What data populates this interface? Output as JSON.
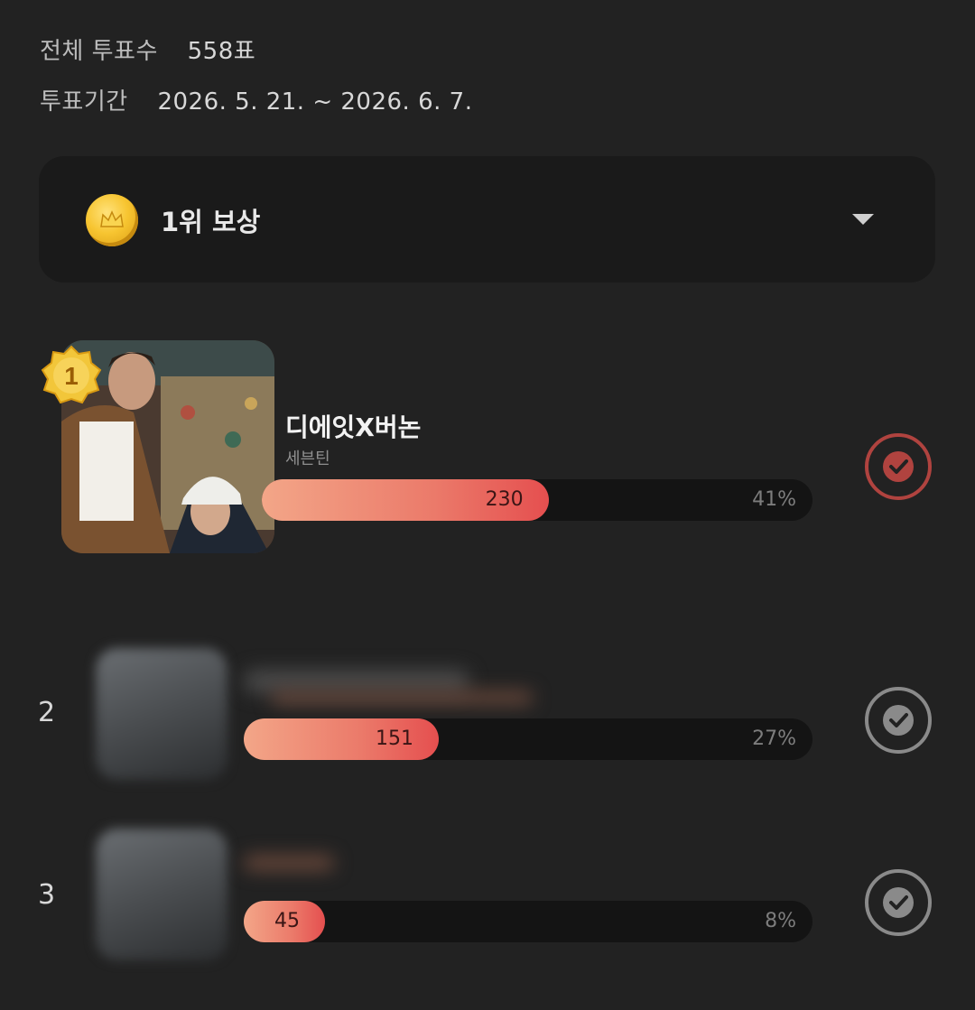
{
  "header": {
    "total_label": "전체 투표수",
    "total_value": "558표",
    "period_label": "투표기간",
    "period_value": "2026. 5. 21. ~ 2026. 6. 7."
  },
  "reward": {
    "title": "1위 보상",
    "icon": "coin-icon",
    "dropdown_icon": "chevron-down-icon"
  },
  "entries": [
    {
      "rank": "1",
      "name": "디에잇X버논",
      "group": "세븐틴",
      "votes": "230",
      "percent": "41%",
      "fraction": 0.41,
      "check_color": "#b0433f"
    },
    {
      "rank": "2",
      "votes": "151",
      "percent": "27%",
      "fraction": 0.27,
      "check_color": "#8a8a8a"
    },
    {
      "rank": "3",
      "votes": "45",
      "percent": "8%",
      "fraction": 0.08,
      "check_color": "#8a8a8a"
    }
  ],
  "colors": {
    "background": "#222222",
    "bar_start": "#f3a688",
    "bar_end": "#e54f4f",
    "track": "#141414"
  }
}
